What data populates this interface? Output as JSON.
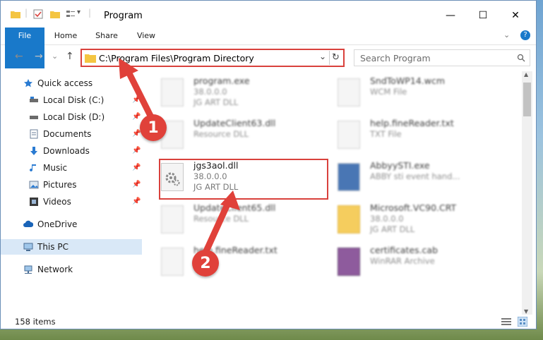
{
  "window": {
    "title": "Program",
    "minimize_glyph": "—",
    "maximize_glyph": "☐",
    "close_glyph": "✕"
  },
  "ribbon": {
    "tabs": [
      "File",
      "Home",
      "Share",
      "View"
    ]
  },
  "address": {
    "path": "C:\\Program Files\\Program Directory",
    "dropdown_glyph": "⌄",
    "refresh_glyph": "↻"
  },
  "search": {
    "placeholder": "Search Program",
    "icon": "search-icon"
  },
  "nav": {
    "back": "←",
    "forward": "→",
    "down": "⌄",
    "up": "↑"
  },
  "sidebar": {
    "items": [
      {
        "label": "Quick access",
        "icon": "star-icon",
        "pinned": false
      },
      {
        "label": "Local Disk (C:)",
        "icon": "drive-icon",
        "pinned": true
      },
      {
        "label": "Local Disk (D:)",
        "icon": "drive-icon",
        "pinned": true
      },
      {
        "label": "Documents",
        "icon": "documents-icon",
        "pinned": true
      },
      {
        "label": "Downloads",
        "icon": "download-icon",
        "pinned": true
      },
      {
        "label": "Music",
        "icon": "music-icon",
        "pinned": true
      },
      {
        "label": "Pictures",
        "icon": "pictures-icon",
        "pinned": true
      },
      {
        "label": "Videos",
        "icon": "videos-icon",
        "pinned": true
      },
      {
        "label": "OneDrive",
        "icon": "cloud-icon",
        "pinned": false
      },
      {
        "label": "This PC",
        "icon": "computer-icon",
        "pinned": false
      },
      {
        "label": "Network",
        "icon": "network-icon",
        "pinned": false
      }
    ]
  },
  "files": [
    {
      "name": "program.exe",
      "line2": "38.0.0.0",
      "line3": "JG ART DLL",
      "blurred": true
    },
    {
      "name": "SndToWP14.wcm",
      "line2": "WCM File",
      "line3": "",
      "blurred": true
    },
    {
      "name": "UpdateClient63.dll",
      "line2": "Resource DLL",
      "line3": "",
      "blurred": true
    },
    {
      "name": "help.fineReader.txt",
      "line2": "TXT File",
      "line3": "",
      "blurred": true
    },
    {
      "name": "jgs3aol.dll",
      "line2": "38.0.0.0",
      "line3": "JG ART DLL",
      "blurred": false
    },
    {
      "name": "AbbyySTI.exe",
      "line2": "ABBY sti event hand...",
      "line3": "",
      "blurred": true
    },
    {
      "name": "UpdateClient65.dll",
      "line2": "Resource DLL",
      "line3": "",
      "blurred": true
    },
    {
      "name": "Microsoft.VC90.CRT",
      "line2": "38.0.0.0",
      "line3": "JG ART DLL",
      "blurred": true
    },
    {
      "name": "help.fineReader.txt",
      "line2": "",
      "line3": "",
      "blurred": true
    },
    {
      "name": "certificates.cab",
      "line2": "WinRAR Archive",
      "line3": "",
      "blurred": true
    }
  ],
  "status": {
    "count": "158 items"
  },
  "annotations": {
    "step1": "1",
    "step2": "2",
    "color": "#e0413a"
  }
}
